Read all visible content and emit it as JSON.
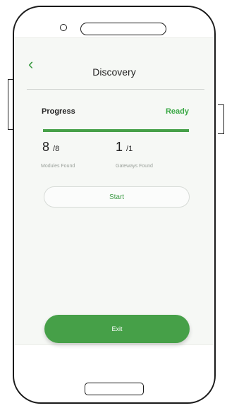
{
  "header": {
    "title": "Discovery",
    "back_icon": "chevron-left-icon"
  },
  "progress": {
    "label": "Progress",
    "status": "Ready",
    "fraction": 1.0
  },
  "stats": {
    "modules": {
      "found": "8",
      "total": "/8",
      "caption": "Modules Found"
    },
    "gateways": {
      "found": "1",
      "total": "/1",
      "caption": "Gateways Found"
    }
  },
  "actions": {
    "start_label": "Start",
    "exit_label": "Exit"
  },
  "colors": {
    "accent": "#46a048",
    "status": "#3aa845"
  }
}
